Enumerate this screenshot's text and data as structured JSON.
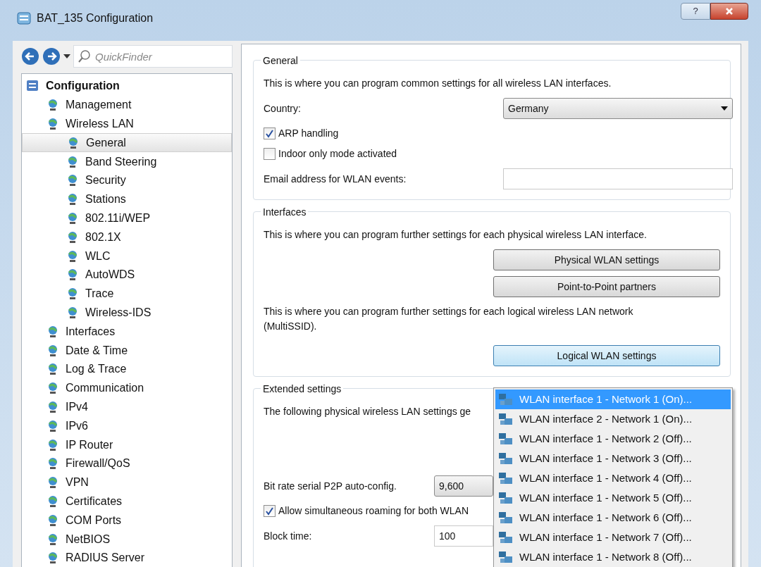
{
  "window": {
    "title": "BAT_135 Configuration",
    "help_button": "?"
  },
  "toolbar": {
    "search": {
      "placeholder": "QuickFinder"
    }
  },
  "tree": [
    {
      "label": "Configuration",
      "selected": false,
      "children": [
        {
          "label": "Management",
          "selected": false
        },
        {
          "label": "Wireless LAN",
          "selected": false,
          "children": [
            {
              "label": "General",
              "selected": true
            },
            {
              "label": "Band Steering",
              "selected": false
            },
            {
              "label": "Security",
              "selected": false
            },
            {
              "label": "Stations",
              "selected": false
            },
            {
              "label": "802.11i/WEP",
              "selected": false
            },
            {
              "label": "802.1X",
              "selected": false
            },
            {
              "label": "WLC",
              "selected": false
            },
            {
              "label": "AutoWDS",
              "selected": false
            },
            {
              "label": "Trace",
              "selected": false
            },
            {
              "label": "Wireless-IDS",
              "selected": false
            }
          ]
        },
        {
          "label": "Interfaces",
          "selected": false
        },
        {
          "label": "Date & Time",
          "selected": false
        },
        {
          "label": "Log & Trace",
          "selected": false
        },
        {
          "label": "Communication",
          "selected": false
        },
        {
          "label": "IPv4",
          "selected": false
        },
        {
          "label": "IPv6",
          "selected": false
        },
        {
          "label": "IP Router",
          "selected": false
        },
        {
          "label": "Firewall/QoS",
          "selected": false
        },
        {
          "label": "VPN",
          "selected": false
        },
        {
          "label": "Certificates",
          "selected": false
        },
        {
          "label": "COM Ports",
          "selected": false
        },
        {
          "label": "NetBIOS",
          "selected": false
        },
        {
          "label": "RADIUS Server",
          "selected": false
        }
      ]
    }
  ],
  "general": {
    "legend": "General",
    "description": "This is where you can program common settings for all wireless LAN interfaces.",
    "country": {
      "label": "Country:",
      "value": "Germany"
    },
    "checkboxes": [
      {
        "label": "ARP handling",
        "checked": true
      },
      {
        "label": "Indoor only mode activated",
        "checked": false
      }
    ],
    "email": {
      "label": "Email address for WLAN events:"
    }
  },
  "interfaces": {
    "legend": "Interfaces",
    "description_physical": "This is where you can program further settings for each physical wireless LAN interface.",
    "physical_buttons": [
      {
        "label": "Physical WLAN settings",
        "focused": false
      },
      {
        "label": "Point-to-Point partners",
        "focused": false
      }
    ],
    "description_logical": "This is where you can program further settings for each logical wireless LAN network (MultiSSID).",
    "logical_button": {
      "label": "Logical WLAN settings",
      "focused": true
    }
  },
  "extended": {
    "legend": "Extended settings",
    "description": "The following physical wireless LAN settings ge",
    "bitrate": {
      "label": "Bit rate serial P2P auto-config.",
      "value": "9,600"
    },
    "roaming": {
      "label": "Allow simultaneous roaming for both WLAN",
      "checked": true
    },
    "block_time": {
      "label": "Block time:",
      "value": "100"
    }
  },
  "menu": [
    {
      "label": "WLAN interface 1 - Network 1 (On)...",
      "selected": true
    },
    {
      "label": "WLAN interface 2 - Network 1 (On)...",
      "selected": false
    },
    {
      "label": "WLAN interface 1 - Network 2 (Off)...",
      "selected": false
    },
    {
      "label": "WLAN interface 1 - Network 3 (Off)...",
      "selected": false
    },
    {
      "label": "WLAN interface 1 - Network 4 (Off)...",
      "selected": false
    },
    {
      "label": "WLAN interface 1 - Network 5 (Off)...",
      "selected": false
    },
    {
      "label": "WLAN interface 1 - Network 6 (Off)...",
      "selected": false
    },
    {
      "label": "WLAN interface 1 - Network 7 (Off)...",
      "selected": false
    },
    {
      "label": "WLAN interface 1 - Network 8 (Off)...",
      "selected": false
    }
  ]
}
